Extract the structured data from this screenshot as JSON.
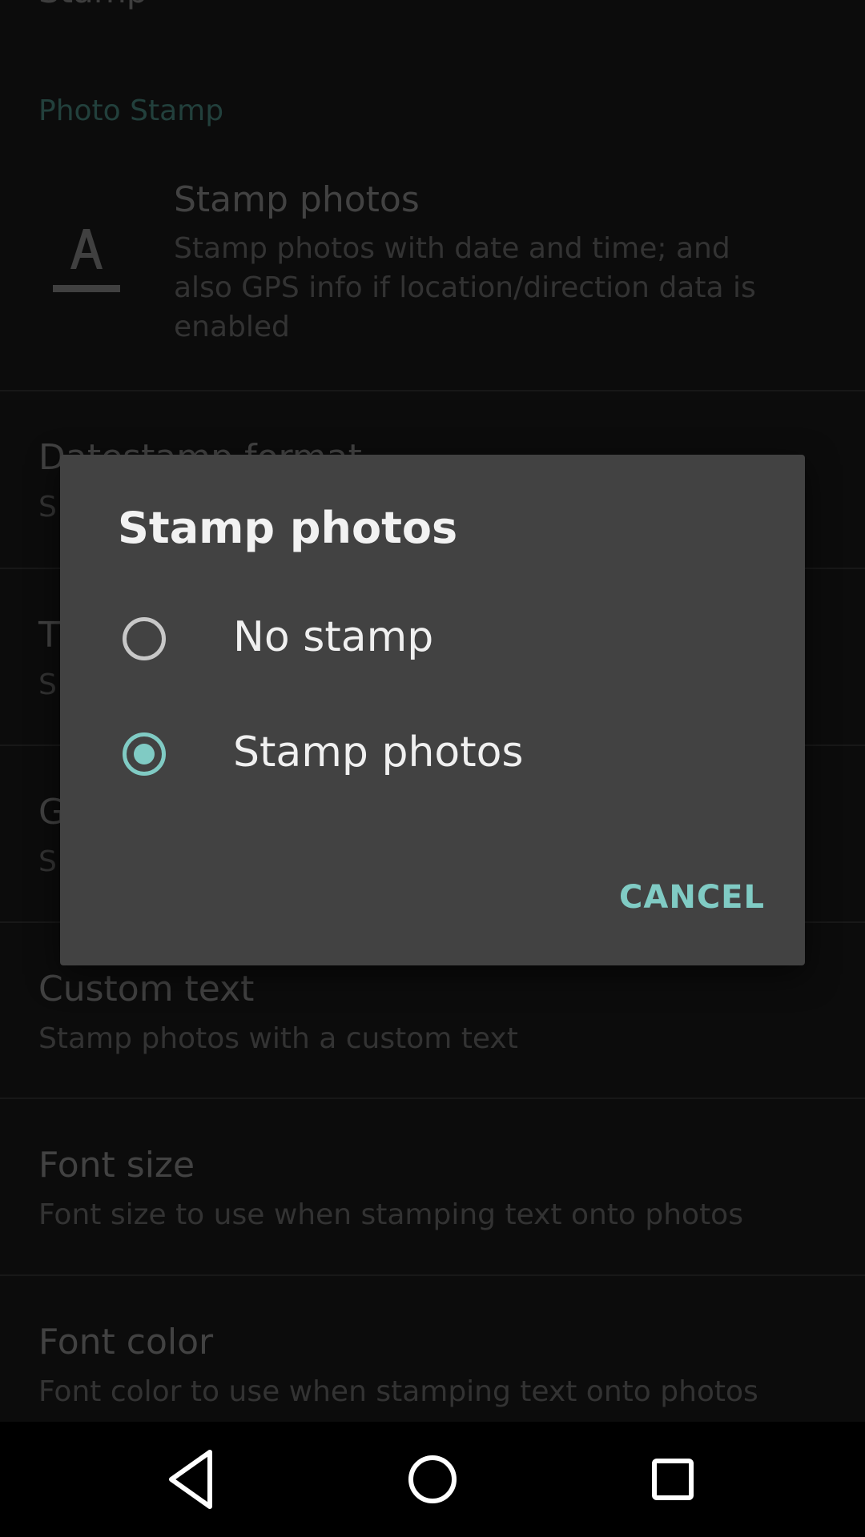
{
  "settings": {
    "cut_title": "Stamp",
    "section_header": "Photo Stamp",
    "items": [
      {
        "title": "Stamp photos",
        "summary_lines": [
          "Stamp photos with date and time; and",
          "also GPS info if location/direction data is",
          "enabled"
        ]
      },
      {
        "title": "Datestamp format",
        "summary": "S"
      },
      {
        "title": "T",
        "summary": "S"
      },
      {
        "title": "G",
        "summary": "S"
      },
      {
        "title": "Custom text",
        "summary": "Stamp photos with a custom text"
      },
      {
        "title": "Font size",
        "summary": "Font size to use when stamping text onto photos"
      },
      {
        "title": "Font color",
        "summary": "Font color to use when stamping text onto photos"
      }
    ],
    "stamp_icon": "text-format-icon"
  },
  "dialog": {
    "title": "Stamp photos",
    "options": [
      {
        "label": "No stamp",
        "selected": false
      },
      {
        "label": "Stamp photos",
        "selected": true
      }
    ],
    "cancel_label": "CANCEL",
    "accent_color": "#80cbc4"
  },
  "navbar": {
    "icons": [
      "back-icon",
      "home-icon",
      "recents-icon"
    ]
  }
}
